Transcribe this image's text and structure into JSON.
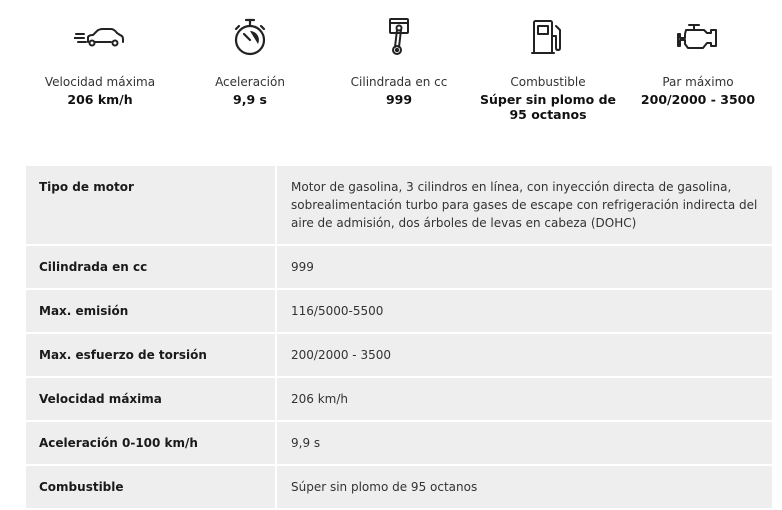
{
  "features": [
    {
      "icon": "car-speed-icon",
      "label": "Velocidad máxima",
      "value": "206 km/h"
    },
    {
      "icon": "stopwatch-icon",
      "label": "Aceleración",
      "value": "9,9 s"
    },
    {
      "icon": "piston-icon",
      "label": "Cilindrada en cc",
      "value": "999"
    },
    {
      "icon": "fuel-pump-icon",
      "label": "Combustible",
      "value": "Súper sin plomo de 95 octanos"
    },
    {
      "icon": "engine-icon",
      "label": "Par máximo",
      "value": "200/2000 - 3500"
    }
  ],
  "specs": [
    {
      "key": "Tipo de motor",
      "value": "Motor de gasolina, 3 cilindros en línea, con inyección directa de gasolina, sobrealimentación turbo para gases de escape con refrigeración indirecta del aire de admisión, dos árboles de levas en cabeza (DOHC)"
    },
    {
      "key": "Cilindrada en cc",
      "value": "999"
    },
    {
      "key": "Max. emisión",
      "value": "116/5000-5500"
    },
    {
      "key": "Max. esfuerzo de torsión",
      "value": "200/2000 - 3500"
    },
    {
      "key": "Velocidad máxima",
      "value": "206 km/h"
    },
    {
      "key": "Aceleración 0-100 km/h",
      "value": "9,9 s"
    },
    {
      "key": "Combustible",
      "value": "Súper sin plomo de 95 octanos"
    }
  ]
}
